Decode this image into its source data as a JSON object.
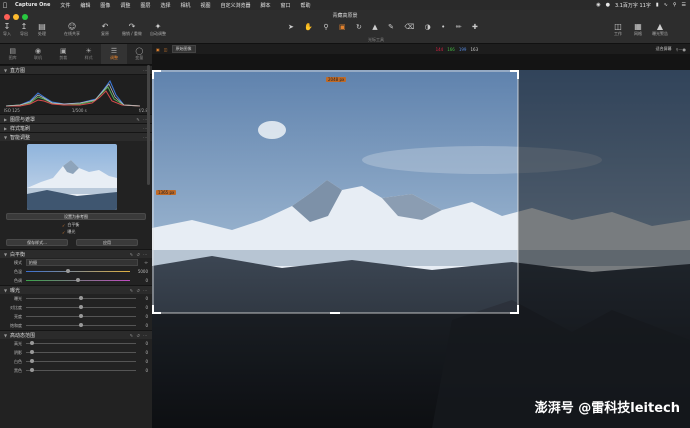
{
  "menubar": {
    "app": "Capture One",
    "items": [
      "文件",
      "编辑",
      "图像",
      "调整",
      "图层",
      "选择",
      "相机",
      "视图",
      "自定义浏览器",
      "脚本",
      "窗口",
      "帮助"
    ],
    "status": "3.1百万字 11字"
  },
  "toolbar": {
    "doc_title": "青藏高原景",
    "left_buttons": [
      {
        "icon": "import-icon",
        "label": "导入"
      },
      {
        "icon": "export-icon",
        "label": "导出"
      },
      {
        "icon": "process-icon",
        "label": "处理"
      },
      {
        "icon": "share-icon",
        "label": "在线共享"
      }
    ],
    "mid_buttons": [
      {
        "icon": "undo-icon",
        "label": "复原"
      },
      {
        "icon": "redo-icon",
        "label": "撤销 / 重做"
      },
      {
        "icon": "auto-adjust-icon",
        "label": "自动调整"
      }
    ],
    "center_tools_label": "光标工具",
    "right_buttons": [
      {
        "icon": "layout-icon",
        "label": "工作"
      },
      {
        "icon": "grid-icon",
        "label": "网格"
      },
      {
        "icon": "warning-icon",
        "label": "曝光警告"
      }
    ]
  },
  "left_panel": {
    "tabs": [
      {
        "label": "图库",
        "icon": "library-icon"
      },
      {
        "label": "联机",
        "icon": "tether-icon"
      },
      {
        "label": "剪裁",
        "icon": "crop-icon"
      },
      {
        "label": "样式",
        "icon": "style-icon"
      },
      {
        "label": "调整",
        "icon": "adjust-icon",
        "active": true
      },
      {
        "label": "变量",
        "icon": "variant-icon"
      }
    ],
    "histogram": {
      "title": "直方图",
      "iso": "ISO 125",
      "shutter": "1/500 s",
      "aperture": "f/2.8"
    },
    "sections": {
      "layers": "图层与遮罩",
      "styles": "样式笔刷",
      "smart": "智能调整",
      "wb": "白平衡",
      "exposure": "曝光",
      "hdr": "高动态范围"
    },
    "smart_adjust": {
      "set_ref": "设置为参考图",
      "wb_check": "白平衡",
      "exposure_check": "曝光",
      "save_style": "保存样式...",
      "apply": "应用"
    },
    "white_balance": {
      "mode_label": "模式",
      "mode_value": "拍摄",
      "kelvin_label": "色温",
      "kelvin_value": "5000",
      "tint_label": "色调",
      "tint_value": "0"
    },
    "exposure_rows": [
      {
        "label": "曝光",
        "value": "0",
        "level": 0.5
      },
      {
        "label": "对比度",
        "value": "0",
        "level": 0.5
      },
      {
        "label": "亮度",
        "value": "0",
        "level": 0.5
      },
      {
        "label": "饱和度",
        "value": "0",
        "level": 0.5
      }
    ],
    "hdr_rows": [
      {
        "label": "高光",
        "value": "0",
        "level": 0.05
      },
      {
        "label": "阴影",
        "value": "0",
        "level": 0.05
      },
      {
        "label": "白色",
        "value": "0",
        "level": 0.05
      },
      {
        "label": "黑色",
        "value": "0",
        "level": 0.05
      }
    ]
  },
  "viewer": {
    "top_selector": "原始图像",
    "rgb": [
      "144",
      "166",
      "199",
      "163"
    ],
    "fit": "适合屏幕",
    "width_chip": "2048 px",
    "height_chip": "1365 px",
    "watermark": "澎湃号 @雷科技leitech"
  },
  "colors": {
    "accent": "#e0812e",
    "panel": "#222222",
    "toolbar": "#2d2d2d"
  }
}
